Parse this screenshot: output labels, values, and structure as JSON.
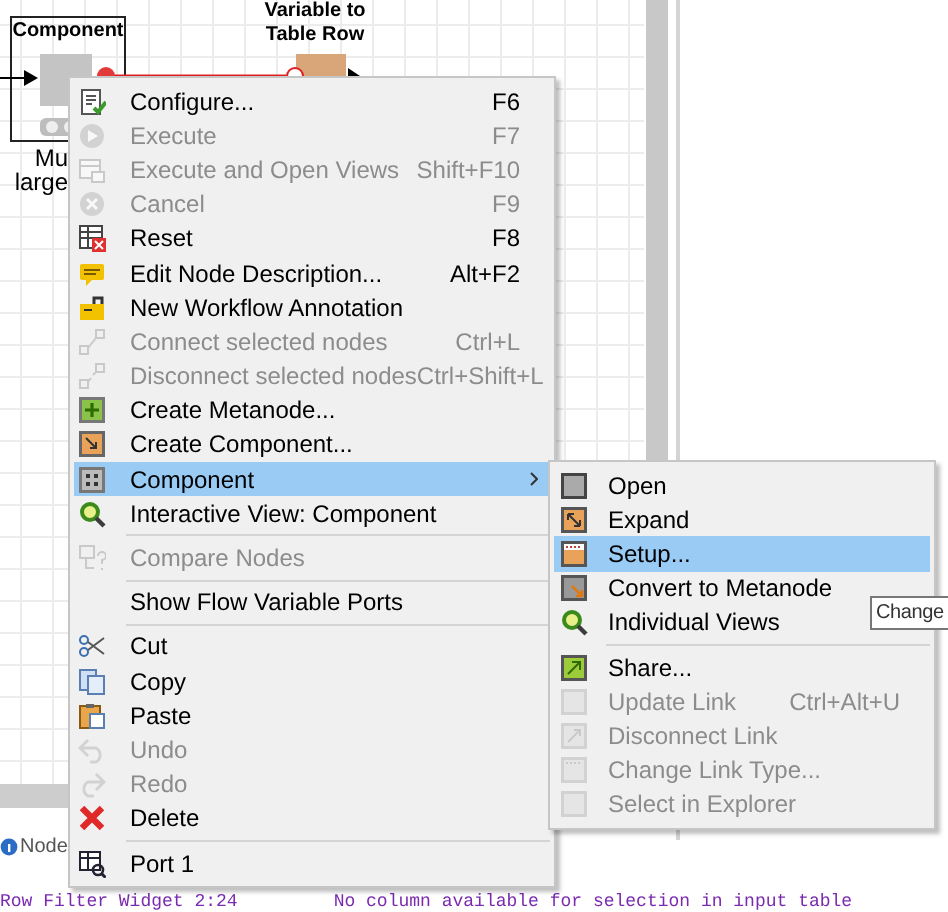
{
  "canvas": {
    "nodes": [
      {
        "kind": "component",
        "title_lines": [
          "Component"
        ],
        "caption_lines": [
          "Mu",
          "large"
        ]
      },
      {
        "kind": "variable",
        "title_lines": [
          "Variable to",
          "Table Row"
        ]
      }
    ]
  },
  "context_menu": {
    "items": [
      {
        "kind": "item",
        "label": "Configure...",
        "shortcut": "F6",
        "disabled": false,
        "selected": false,
        "has_submenu": false
      },
      {
        "kind": "item",
        "label": "Execute",
        "shortcut": "F7",
        "disabled": true,
        "selected": false,
        "has_submenu": false
      },
      {
        "kind": "item",
        "label": "Execute and Open Views",
        "shortcut": "Shift+F10",
        "disabled": true,
        "selected": false,
        "has_submenu": false
      },
      {
        "kind": "item",
        "label": "Cancel",
        "shortcut": "F9",
        "disabled": true,
        "selected": false,
        "has_submenu": false
      },
      {
        "kind": "item",
        "label": "Reset",
        "shortcut": "F8",
        "disabled": false,
        "selected": false,
        "has_submenu": false
      },
      {
        "kind": "item",
        "label": "Edit Node Description...",
        "shortcut": "Alt+F2",
        "disabled": false,
        "selected": false,
        "has_submenu": false
      },
      {
        "kind": "item",
        "label": "New Workflow Annotation",
        "disabled": false,
        "selected": false,
        "has_submenu": false
      },
      {
        "kind": "item",
        "label": "Connect selected nodes",
        "shortcut": "Ctrl+L",
        "disabled": true,
        "selected": false,
        "has_submenu": false
      },
      {
        "kind": "item",
        "label": "Disconnect selected nodes",
        "shortcut": "Ctrl+Shift+L",
        "disabled": true,
        "selected": false,
        "has_submenu": false
      },
      {
        "kind": "item",
        "label": "Create Metanode...",
        "disabled": false,
        "selected": false,
        "has_submenu": false
      },
      {
        "kind": "item",
        "label": "Create Component...",
        "disabled": false,
        "selected": false,
        "has_submenu": false
      },
      {
        "kind": "item",
        "label": "Component",
        "disabled": false,
        "selected": true,
        "has_submenu": true
      },
      {
        "kind": "item",
        "label": "Interactive View: Component",
        "disabled": false,
        "selected": false,
        "has_submenu": false
      },
      {
        "kind": "separator"
      },
      {
        "kind": "item",
        "label": "Compare Nodes",
        "disabled": true,
        "selected": false,
        "has_submenu": false
      },
      {
        "kind": "separator"
      },
      {
        "kind": "item",
        "label": "Show Flow Variable Ports",
        "disabled": false,
        "selected": false,
        "has_submenu": false
      },
      {
        "kind": "separator"
      },
      {
        "kind": "item",
        "label": "Cut",
        "disabled": false,
        "selected": false,
        "has_submenu": false
      },
      {
        "kind": "item",
        "label": "Copy",
        "disabled": false,
        "selected": false,
        "has_submenu": false
      },
      {
        "kind": "item",
        "label": "Paste",
        "disabled": false,
        "selected": false,
        "has_submenu": false
      },
      {
        "kind": "item",
        "label": "Undo",
        "disabled": true,
        "selected": false,
        "has_submenu": false
      },
      {
        "kind": "item",
        "label": "Redo",
        "disabled": true,
        "selected": false,
        "has_submenu": false
      },
      {
        "kind": "item",
        "label": "Delete",
        "disabled": false,
        "selected": false,
        "has_submenu": false
      },
      {
        "kind": "separator"
      },
      {
        "kind": "item",
        "label": "Port 1",
        "disabled": false,
        "selected": false,
        "has_submenu": false
      }
    ]
  },
  "submenu": {
    "items": [
      {
        "kind": "item",
        "label": "Open",
        "disabled": false,
        "selected": false,
        "has_submenu": false
      },
      {
        "kind": "item",
        "label": "Expand",
        "disabled": false,
        "selected": false,
        "has_submenu": false
      },
      {
        "kind": "item",
        "label": "Setup...",
        "disabled": false,
        "selected": true,
        "has_submenu": false
      },
      {
        "kind": "item",
        "label": "Convert to Metanode",
        "disabled": false,
        "selected": false,
        "has_submenu": false
      },
      {
        "kind": "item",
        "label": "Individual Views",
        "disabled": false,
        "selected": false,
        "has_submenu": false
      },
      {
        "kind": "separator"
      },
      {
        "kind": "item",
        "label": "Share...",
        "disabled": false,
        "selected": false,
        "has_submenu": false
      },
      {
        "kind": "item",
        "label": "Update Link",
        "shortcut": "Ctrl+Alt+U",
        "disabled": true,
        "selected": false,
        "has_submenu": false
      },
      {
        "kind": "item",
        "label": "Disconnect Link",
        "disabled": true,
        "selected": false,
        "has_submenu": false
      },
      {
        "kind": "item",
        "label": "Change Link Type...",
        "disabled": true,
        "selected": false,
        "has_submenu": false
      },
      {
        "kind": "item",
        "label": "Select in Explorer",
        "disabled": true,
        "selected": false,
        "has_submenu": false
      }
    ]
  },
  "tooltip": {
    "text": "Change"
  },
  "bottom_panel": {
    "tab": "Node",
    "console": [
      {
        "text": "Row Filter Widget 2:24"
      },
      {
        "text": "No column available for selection in input table"
      }
    ]
  }
}
